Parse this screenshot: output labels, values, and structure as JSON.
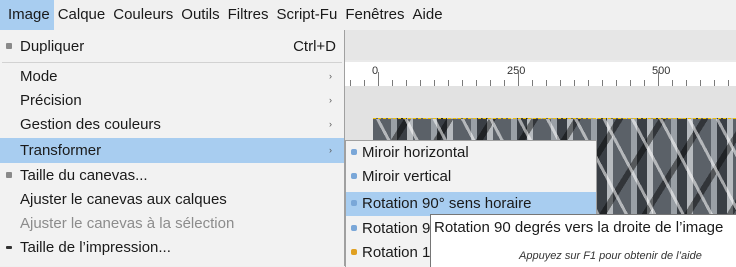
{
  "menubar": {
    "items": [
      "Image",
      "Calque",
      "Couleurs",
      "Outils",
      "Filtres",
      "Script-Fu",
      "Fenêtres",
      "Aide"
    ]
  },
  "ruler": {
    "labels": [
      "0",
      "250",
      "500"
    ]
  },
  "image_menu": {
    "items": [
      {
        "label": "Dupliquer",
        "shortcut": "Ctrl+D",
        "icon": "duplicate-icon"
      },
      {
        "label": "Mode",
        "submenu": true
      },
      {
        "label": "Précision",
        "submenu": true
      },
      {
        "label": "Gestion des couleurs",
        "submenu": true
      },
      {
        "label": "Transformer",
        "submenu": true,
        "highlighted": true
      },
      {
        "label": "Taille du canevas...",
        "icon": "canvas-size-icon"
      },
      {
        "label": "Ajuster le canevas aux calques"
      },
      {
        "label": "Ajuster le canevas à la sélection",
        "disabled": true
      },
      {
        "label": "Taille de l’impression...",
        "icon": "print-size-icon"
      }
    ]
  },
  "transform_submenu": {
    "items": [
      {
        "label": "Miroir horizontal",
        "icon": "flip-horizontal-icon"
      },
      {
        "label": "Miroir vertical",
        "icon": "flip-vertical-icon"
      },
      {
        "label": "Rotation 90° sens horaire",
        "icon": "rotate-cw-icon",
        "highlighted": true
      },
      {
        "label": "Rotation 9",
        "icon": "rotate-ccw-icon"
      },
      {
        "label": "Rotation 1",
        "icon": "rotate-180-icon"
      }
    ]
  },
  "tooltip": {
    "text": "Rotation 90 degrés vers la droite de l’image",
    "help": "Appuyez sur F1 pour obtenir de l’aide"
  },
  "colors": {
    "highlight": "#a8cdf0",
    "menu_bg": "#f2f2f2",
    "selection_border": "#f2c200"
  }
}
